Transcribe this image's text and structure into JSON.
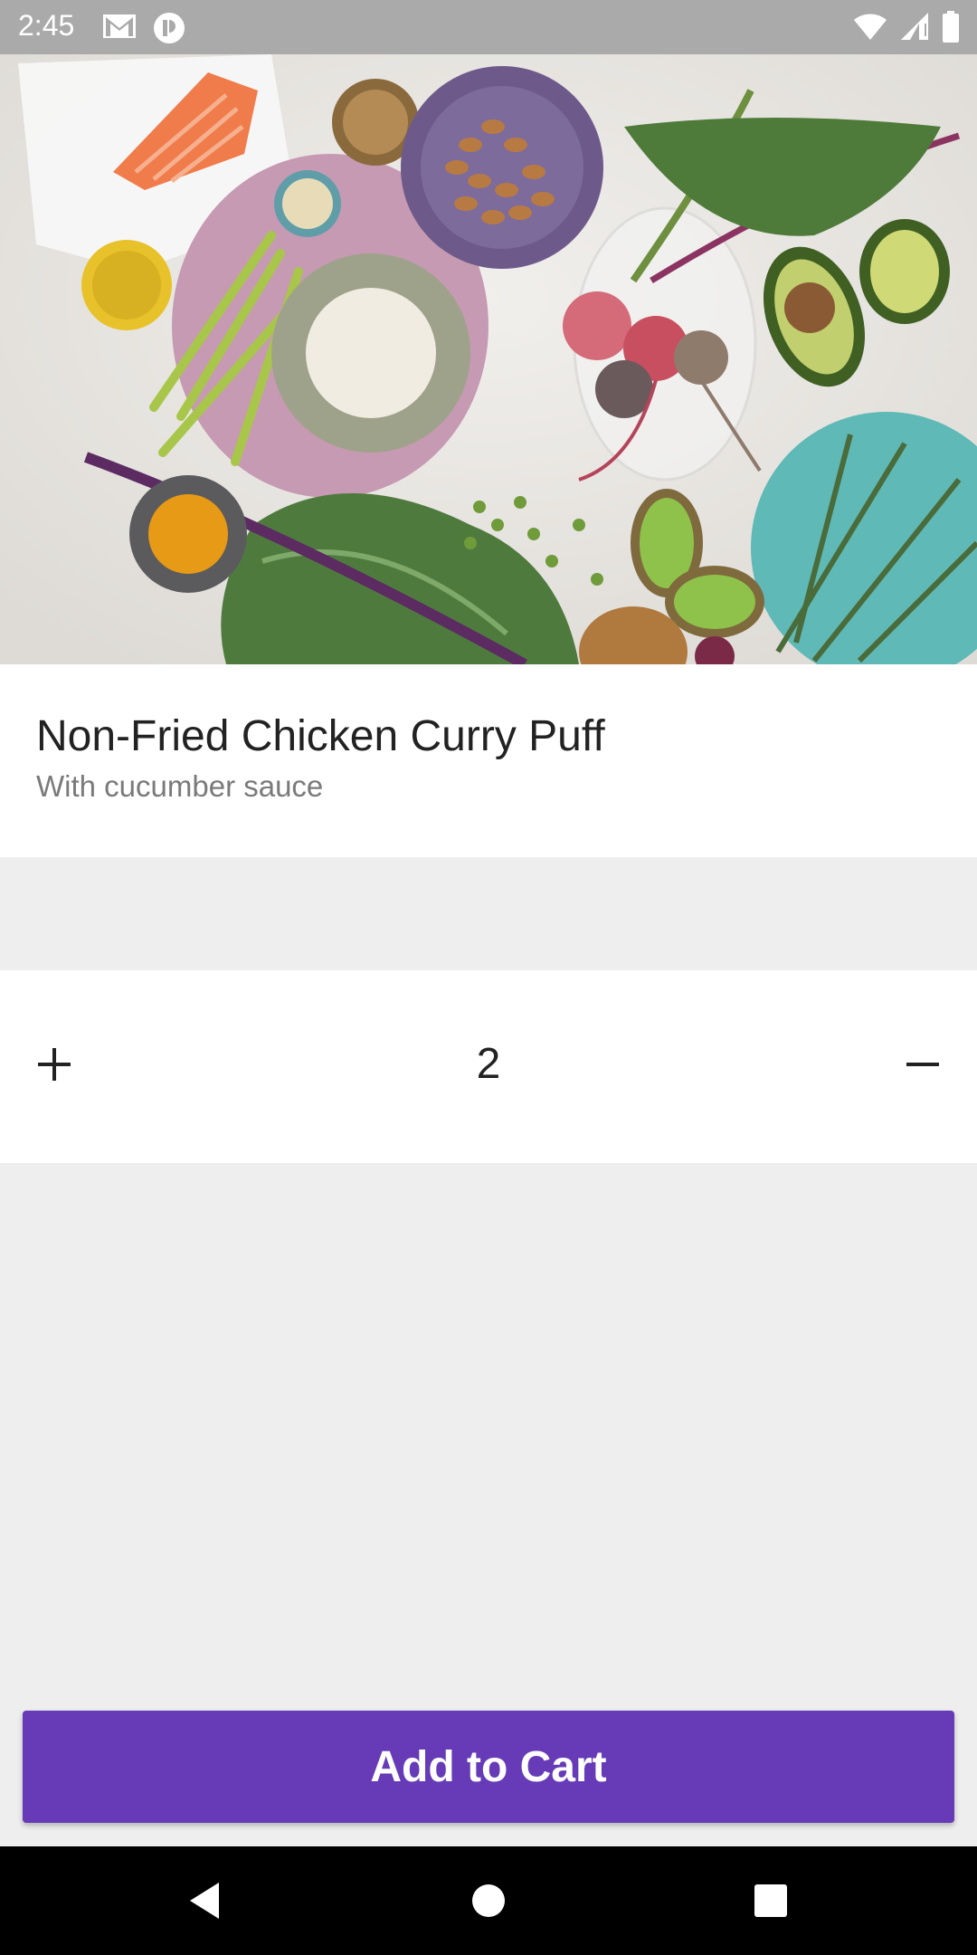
{
  "status_bar": {
    "time": "2:45",
    "left_icons": [
      "gmail-icon",
      "app-notification-icon"
    ],
    "right_icons": [
      "wifi-icon",
      "cell-signal-icon",
      "battery-icon"
    ]
  },
  "hero": {
    "icon": "food-ingredients-photo"
  },
  "product": {
    "title": "Non-Fried Chicken Curry Puff",
    "subtitle": "With cucumber sauce"
  },
  "quantity": {
    "value": "2",
    "increment_icon": "plus-icon",
    "decrement_icon": "minus-icon"
  },
  "cta": {
    "label": "Add to Cart",
    "color": "#673ab7"
  },
  "nav_bar": {
    "icons": [
      "back-icon",
      "home-icon",
      "recents-icon"
    ]
  }
}
